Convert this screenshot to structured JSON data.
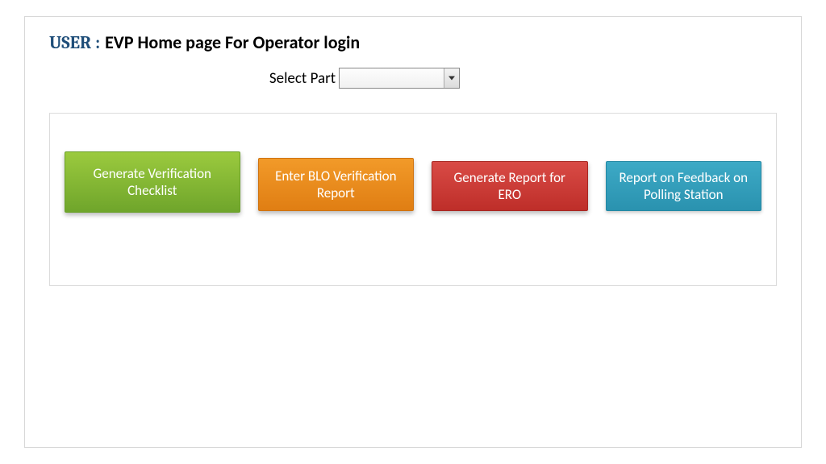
{
  "header": {
    "user_prefix": "USER :",
    "title": "EVP Home page For Operator login"
  },
  "selector": {
    "label": "Select Part",
    "value": ""
  },
  "actions": {
    "generate_checklist": "Generate Verification Checklist",
    "enter_blo_report": "Enter BLO Verification Report",
    "generate_ero_report": "Generate Report for ERO",
    "feedback_polling": "Report on Feedback on Polling Station"
  }
}
